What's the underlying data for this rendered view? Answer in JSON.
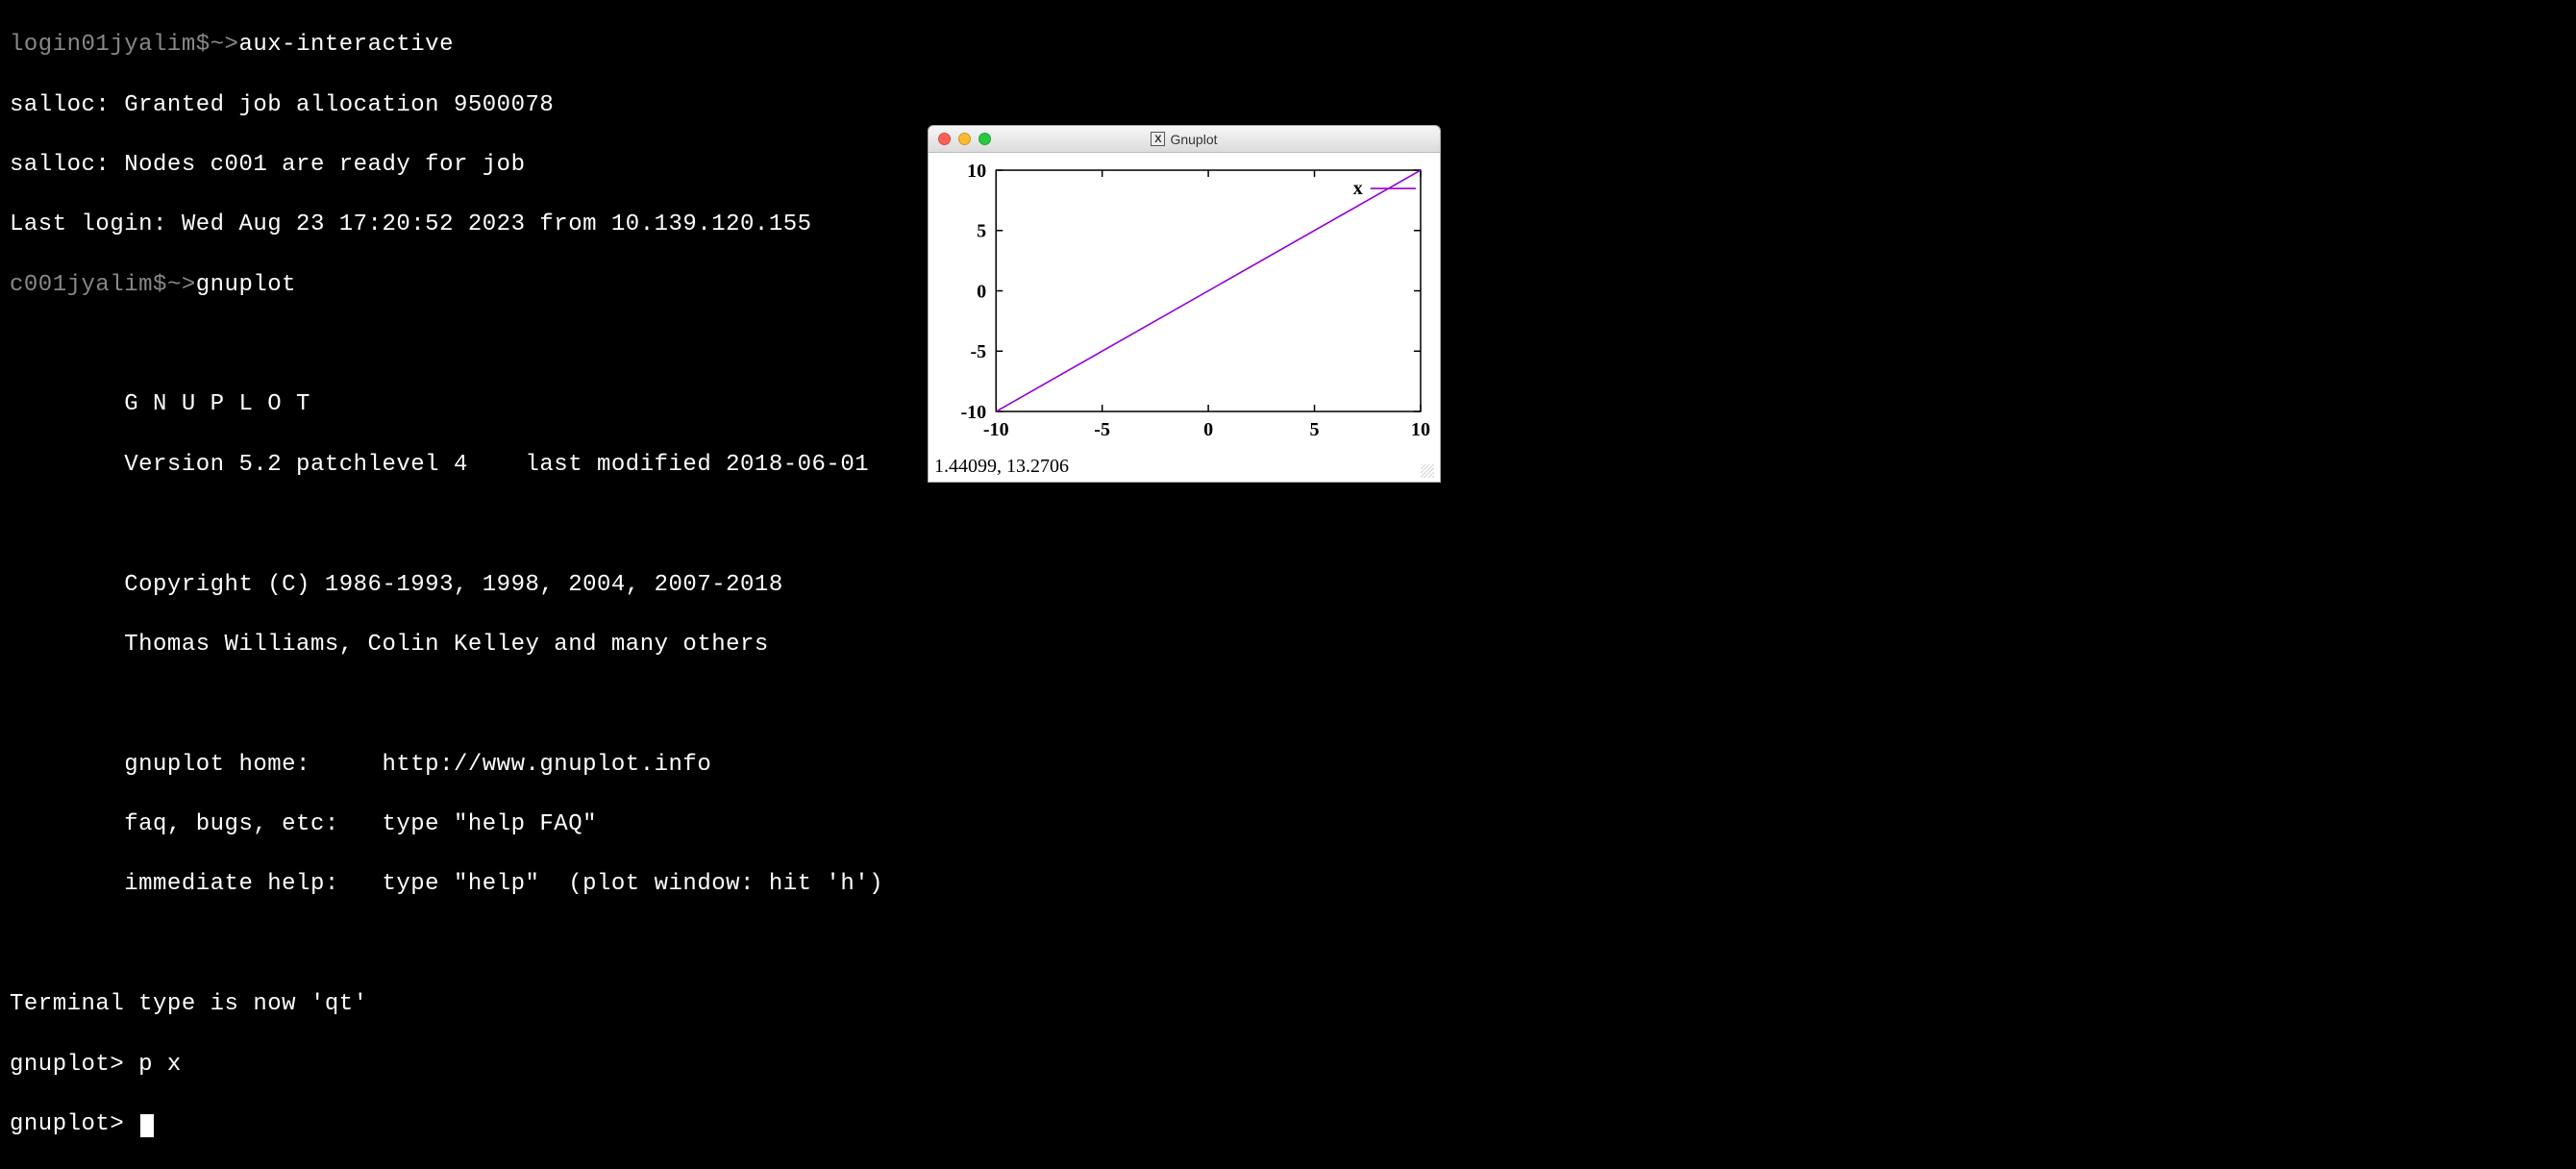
{
  "terminal": {
    "line1_host": "login01jyalim$",
    "line1_sep": "~>",
    "line1_cmd": "aux-interactive",
    "line2": "salloc: Granted job allocation 9500078",
    "line3": "salloc: Nodes c001 are ready for job",
    "line4": "Last login: Wed Aug 23 17:20:52 2023 from 10.139.120.155",
    "line5_host": "c001jyalim$",
    "line5_sep": "~>",
    "line5_cmd": "gnuplot",
    "banner_title": "G N U P L O T",
    "banner_version": "Version 5.2 patchlevel 4    last modified 2018-06-01",
    "banner_copyright": "Copyright (C) 1986-1993, 1998, 2004, 2007-2018",
    "banner_authors": "Thomas Williams, Colin Kelley and many others",
    "banner_home": "gnuplot home:     http://www.gnuplot.info",
    "banner_faq": "faq, bugs, etc:   type \"help FAQ\"",
    "banner_help": "immediate help:   type \"help\"  (plot window: hit 'h')",
    "term_line": "Terminal type is now 'qt'",
    "prompt": "gnuplot> ",
    "cmd_px": "p x"
  },
  "window": {
    "title": "Gnuplot",
    "coord_readout": "1.44099, 13.2706"
  },
  "chart_data": {
    "type": "line",
    "series": [
      {
        "name": "x",
        "color": "#9400d3",
        "x": [
          -10,
          10
        ],
        "y": [
          -10,
          10
        ]
      }
    ],
    "xlim": [
      -10,
      10
    ],
    "ylim": [
      -10,
      10
    ],
    "xticks": [
      -10,
      -5,
      0,
      5,
      10
    ],
    "yticks": [
      -10,
      -5,
      0,
      5,
      10
    ],
    "xlabel": "",
    "ylabel": "",
    "title": "",
    "legend_position": "top-right"
  }
}
